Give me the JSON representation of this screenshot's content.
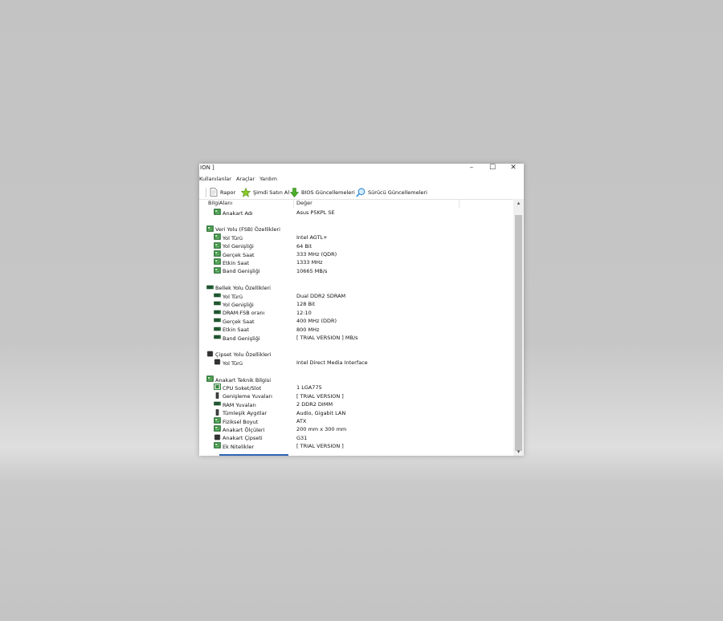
{
  "window": {
    "title": "ION ]",
    "minimize": "–",
    "maximize": "☐",
    "close": "✕"
  },
  "menu": [
    "Kullanılanlar",
    "Araçlar",
    "Yardım"
  ],
  "toolbar": {
    "rapor": "Rapor",
    "buy": "Şimdi Satın Al",
    "bios": "BIOS Güncellemeleri",
    "driver": "Sürücü Güncellemeleri"
  },
  "columns": {
    "field": "BilgiAlanı",
    "value": "Değer"
  },
  "rows": [
    {
      "level": 1,
      "icon": "board",
      "name": "Anakart Adı",
      "value": "Asus P5KPL SE"
    },
    {
      "level": 0,
      "icon": "none",
      "name": "",
      "value": ""
    },
    {
      "level": 0,
      "icon": "board",
      "name": "Veri Yolu (FSB) Özellikleri",
      "value": ""
    },
    {
      "level": 1,
      "icon": "board",
      "name": "Yol Türü",
      "value": "Intel AGTL+"
    },
    {
      "level": 1,
      "icon": "board",
      "name": "Yol Genişliği",
      "value": "64 Bit"
    },
    {
      "level": 1,
      "icon": "board",
      "name": "Gerçek Saat",
      "value": "333 MHz (QDR)"
    },
    {
      "level": 1,
      "icon": "board",
      "name": "Etkin Saat",
      "value": "1333 MHz"
    },
    {
      "level": 1,
      "icon": "board",
      "name": "Band Genişliği",
      "value": "10665 MB/s"
    },
    {
      "level": 0,
      "icon": "none",
      "name": "",
      "value": ""
    },
    {
      "level": 0,
      "icon": "ram",
      "name": "Bellek Yolu Özellikleri",
      "value": ""
    },
    {
      "level": 1,
      "icon": "ram",
      "name": "Yol Türü",
      "value": "Dual DDR2 SDRAM"
    },
    {
      "level": 1,
      "icon": "ram",
      "name": "Yol Genişliği",
      "value": "128 Bit"
    },
    {
      "level": 1,
      "icon": "ram",
      "name": "DRAM:FSB oranı",
      "value": "12:10"
    },
    {
      "level": 1,
      "icon": "ram",
      "name": "Gerçek Saat",
      "value": "400 MHz (DDR)"
    },
    {
      "level": 1,
      "icon": "ram",
      "name": "Etkin Saat",
      "value": "800 MHz"
    },
    {
      "level": 1,
      "icon": "ram",
      "name": "Band Genişliği",
      "value": "[ TRIAL VERSION ] MB/s"
    },
    {
      "level": 0,
      "icon": "none",
      "name": "",
      "value": ""
    },
    {
      "level": 0,
      "icon": "chip",
      "name": "Çipset Yolu Özellikleri",
      "value": ""
    },
    {
      "level": 1,
      "icon": "chip",
      "name": "Yol Türü",
      "value": "Intel Direct Media Interface"
    },
    {
      "level": 0,
      "icon": "none",
      "name": "",
      "value": ""
    },
    {
      "level": 0,
      "icon": "board",
      "name": "Anakart Teknik Bilgisi",
      "value": ""
    },
    {
      "level": 1,
      "icon": "cpu",
      "name": "CPU Soket/Slot",
      "value": "1 LGA775"
    },
    {
      "level": 1,
      "icon": "slot",
      "name": "Genişleme Yuvaları",
      "value": "[ TRIAL VERSION ]"
    },
    {
      "level": 1,
      "icon": "ram",
      "name": "RAM Yuvaları",
      "value": "2 DDR2 DIMM"
    },
    {
      "level": 1,
      "icon": "slot",
      "name": "Tümleşik Aygıtlar",
      "value": "Audio, Gigabit LAN"
    },
    {
      "level": 1,
      "icon": "board",
      "name": "Fiziksel Boyut",
      "value": "ATX"
    },
    {
      "level": 1,
      "icon": "board",
      "name": "Anakart Ölçüleri",
      "value": "200 mm x 300 mm"
    },
    {
      "level": 1,
      "icon": "chip",
      "name": "Anakart Çipseti",
      "value": "G31"
    },
    {
      "level": 1,
      "icon": "board",
      "name": "Ek Nitelikler",
      "value": "[ TRIAL VERSION ]"
    }
  ],
  "colors": {
    "board_green": "#2f8a3a",
    "selection_blue": "#2e64b6",
    "buy_star": "#8ccc2a",
    "bios_arrow": "#4caf2a",
    "driver_search": "#3a8fd6"
  },
  "icons": {
    "rapor": "report-page-icon",
    "buy": "star-buy-icon",
    "bios": "green-down-arrow-icon",
    "driver": "magnifier-icon"
  }
}
